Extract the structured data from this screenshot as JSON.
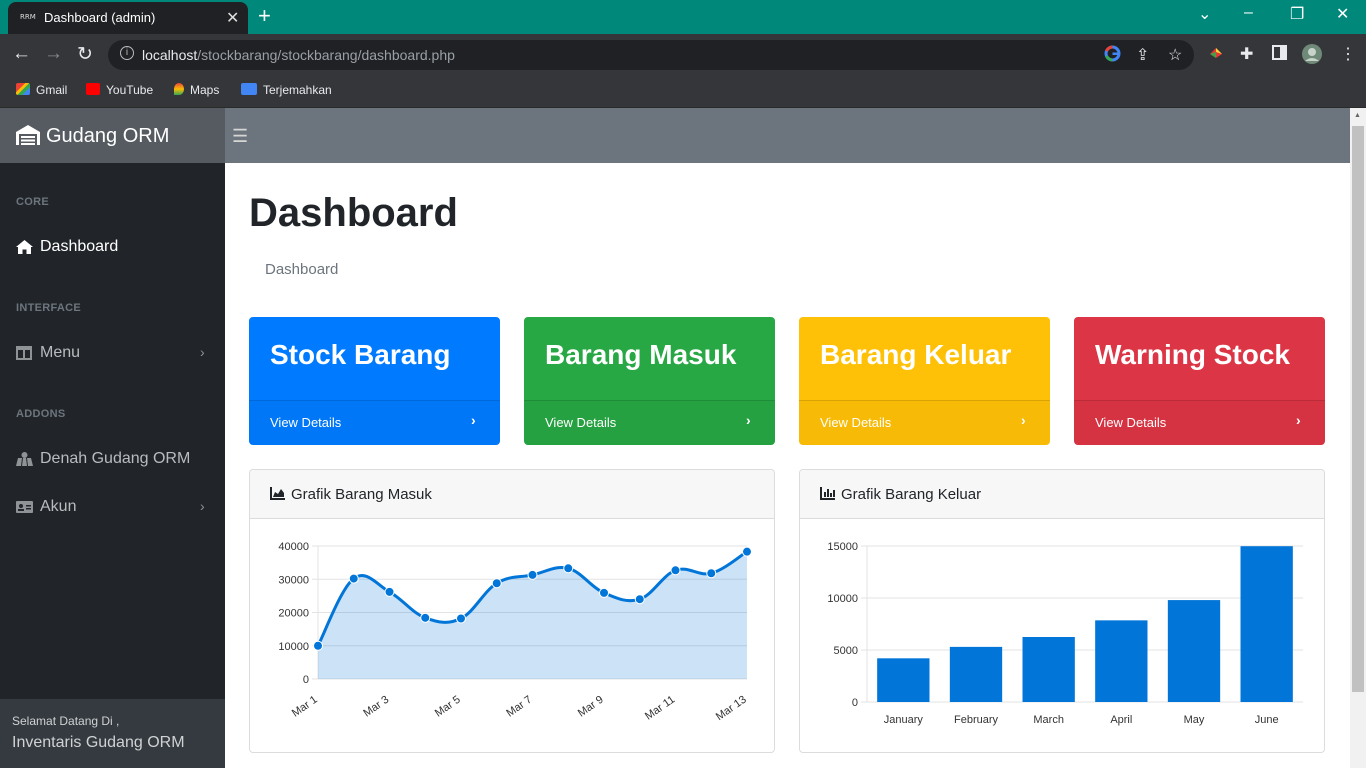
{
  "browser": {
    "tab_title": "Dashboard (admin)",
    "tab_favicon": "RRM",
    "url_host": "localhost",
    "url_path": "/stockbarang/stockbarang/dashboard.php",
    "bookmarks": [
      {
        "label": "Gmail",
        "icon": "gmail-icon"
      },
      {
        "label": "YouTube",
        "icon": "youtube-icon"
      },
      {
        "label": "Maps",
        "icon": "maps-icon"
      },
      {
        "label": "Terjemahkan",
        "icon": "translate-icon"
      }
    ]
  },
  "app": {
    "brand": "Gudang ORM"
  },
  "sidebar": {
    "heading_core": "CORE",
    "heading_interface": "INTERFACE",
    "heading_addons": "ADDONS",
    "items": [
      {
        "label": "Dashboard",
        "icon": "home-icon"
      },
      {
        "label": "Menu",
        "icon": "columns-icon"
      },
      {
        "label": "Denah Gudang ORM",
        "icon": "map-icon"
      },
      {
        "label": "Akun",
        "icon": "id-card-icon"
      }
    ],
    "footer_line1": "Selamat Datang Di ,",
    "footer_line2": "Inventaris Gudang ORM"
  },
  "main": {
    "title": "Dashboard",
    "breadcrumb": "Dashboard",
    "cards": [
      {
        "title": "Stock Barang",
        "link": "View Details",
        "color": "#007bff"
      },
      {
        "title": "Barang Masuk",
        "link": "View Details",
        "color": "#28a745"
      },
      {
        "title": "Barang Keluar",
        "link": "View Details",
        "color": "#ffc107"
      },
      {
        "title": "Warning Stock",
        "link": "View Details",
        "color": "#dc3545"
      }
    ],
    "panel_masuk_title": "Grafik Barang Masuk",
    "panel_keluar_title": "Grafik Barang Keluar"
  },
  "chart_data": [
    {
      "type": "area",
      "title": "Grafik Barang Masuk",
      "x": [
        "Mar 1",
        "Mar 2",
        "Mar 3",
        "Mar 4",
        "Mar 5",
        "Mar 6",
        "Mar 7",
        "Mar 8",
        "Mar 9",
        "Mar 10",
        "Mar 11",
        "Mar 12",
        "Mar 13"
      ],
      "x_tick_labels": [
        "Mar 1",
        "Mar 3",
        "Mar 5",
        "Mar 7",
        "Mar 9",
        "Mar 11",
        "Mar 13"
      ],
      "values": [
        10000,
        30200,
        26200,
        18400,
        18200,
        28800,
        31300,
        33300,
        25900,
        24000,
        32700,
        31800,
        38300
      ],
      "ylim": [
        0,
        40000
      ],
      "y_ticks": [
        0,
        10000,
        20000,
        30000,
        40000
      ],
      "grid": true,
      "color": "#0275d8",
      "fill": "rgba(2,117,216,0.2)"
    },
    {
      "type": "bar",
      "title": "Grafik Barang Keluar",
      "categories": [
        "January",
        "February",
        "March",
        "April",
        "May",
        "June"
      ],
      "values": [
        4200,
        5300,
        6250,
        7850,
        9800,
        14980
      ],
      "ylim": [
        0,
        15000
      ],
      "y_ticks": [
        0,
        5000,
        10000,
        15000
      ],
      "grid": true,
      "color": "#0275d8"
    }
  ]
}
